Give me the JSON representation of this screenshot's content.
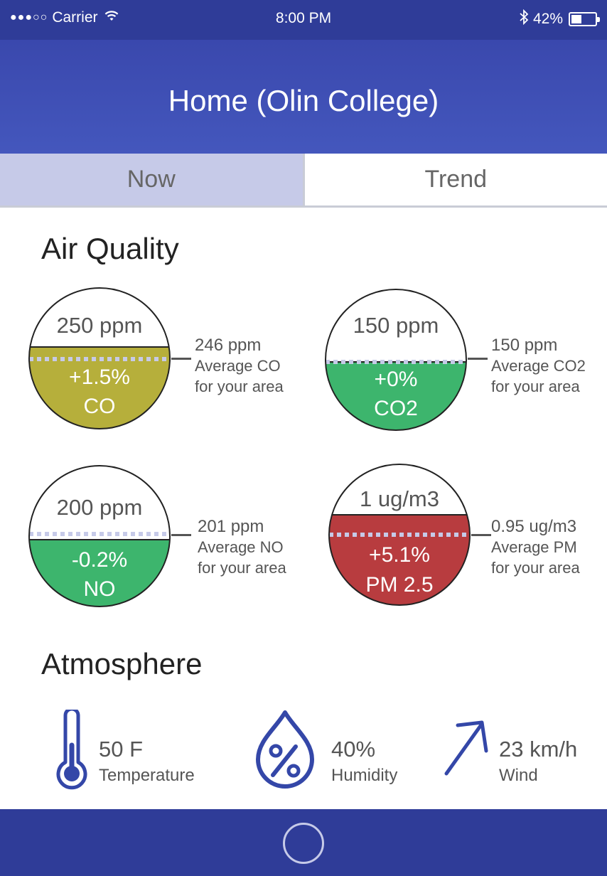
{
  "status_bar": {
    "carrier": "Carrier",
    "time": "8:00 PM",
    "battery": "42%",
    "battery_level": 0.42
  },
  "header": {
    "title": "Home (Olin College)"
  },
  "tabs": [
    {
      "label": "Now",
      "active": true
    },
    {
      "label": "Trend",
      "active": false
    }
  ],
  "air_quality": {
    "title": "Air Quality",
    "gauges": [
      {
        "reading": "250 ppm",
        "change": "+1.5%",
        "pollutant": "CO",
        "average": "246 ppm",
        "avg_label_1": "Average CO",
        "avg_label_2": "for your area",
        "color": "#b6af3b"
      },
      {
        "reading": "150 ppm",
        "change": "+0%",
        "pollutant": "CO2",
        "average": "150 ppm",
        "avg_label_1": "Average CO2",
        "avg_label_2": "for your area",
        "color": "#3db56d"
      },
      {
        "reading": "200 ppm",
        "change": "-0.2%",
        "pollutant": "NO",
        "average": "201 ppm",
        "avg_label_1": "Average NO",
        "avg_label_2": "for your area",
        "color": "#3db56d"
      },
      {
        "reading": "1 ug/m3",
        "change": "+5.1%",
        "pollutant": "PM 2.5",
        "average": "0.95 ug/m3",
        "avg_label_1": "Average PM",
        "avg_label_2": "for your area",
        "color": "#b83c3f"
      }
    ]
  },
  "atmosphere": {
    "title": "Atmosphere",
    "temperature": {
      "value": "50 F",
      "label": "Temperature",
      "icon": "thermometer-icon"
    },
    "humidity": {
      "value": "40%",
      "label": "Humidity",
      "icon": "humidity-drop-icon"
    },
    "wind": {
      "value": "23 km/h",
      "label": "Wind",
      "icon": "wind-arrow-icon"
    }
  },
  "colors": {
    "primary": "#2f3c98",
    "header": "#3f50b5",
    "tab_active": "#c6cae8",
    "icon": "#3447a8"
  }
}
